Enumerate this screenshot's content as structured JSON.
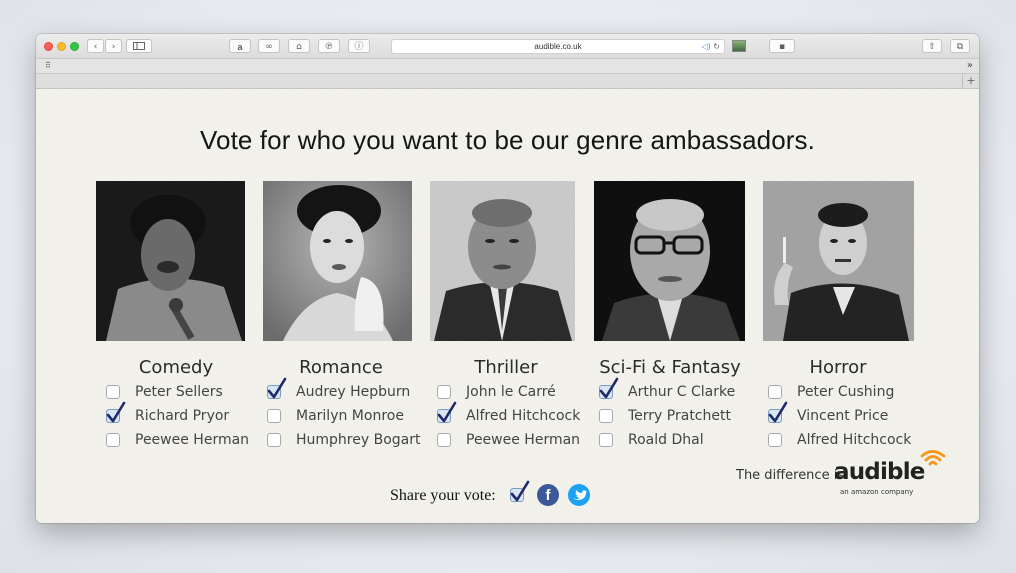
{
  "browser": {
    "url": "audible.co.uk",
    "colors": {
      "close": "#fc5f57",
      "minimize": "#fdbc2e",
      "zoom": "#33c748"
    },
    "toolbar_icons": [
      "back-icon",
      "forward-icon",
      "sidebar-icon",
      "amazon-icon",
      "link-icon",
      "home-icon",
      "pinterest-icon",
      "info-icon",
      "audio-icon",
      "reload-icon",
      "share-icon",
      "tabs-icon",
      "grid-icon",
      "new-tab-icon"
    ],
    "overflow_label": "»",
    "new_tab_label": "+"
  },
  "page": {
    "headline": "Vote for who you want to be our genre ambassadors.",
    "genres": [
      {
        "name": "Comedy",
        "options": [
          {
            "label": "Peter Sellers",
            "checked": false
          },
          {
            "label": "Richard Pryor",
            "checked": true
          },
          {
            "label": "Peewee Herman",
            "checked": false
          }
        ]
      },
      {
        "name": "Romance",
        "options": [
          {
            "label": "Audrey Hepburn",
            "checked": true
          },
          {
            "label": "Marilyn Monroe",
            "checked": false
          },
          {
            "label": "Humphrey Bogart",
            "checked": false
          }
        ]
      },
      {
        "name": "Thriller",
        "options": [
          {
            "label": "John le Carré",
            "checked": false
          },
          {
            "label": "Alfred Hitchcock",
            "checked": true
          },
          {
            "label": "Peewee Herman",
            "checked": false
          }
        ]
      },
      {
        "name": "Sci-Fi & Fantasy",
        "options": [
          {
            "label": "Arthur C Clarke",
            "checked": true
          },
          {
            "label": "Terry Pratchett",
            "checked": false
          },
          {
            "label": "Roald Dhal",
            "checked": false
          }
        ]
      },
      {
        "name": "Horror",
        "options": [
          {
            "label": "Peter Cushing",
            "checked": false
          },
          {
            "label": "Vincent Price",
            "checked": true
          },
          {
            "label": "Alfred Hitchcock",
            "checked": false
          }
        ]
      }
    ],
    "share": {
      "label": "Share your vote:",
      "facebook_glyph": "f",
      "colors": {
        "facebook": "#3b5998",
        "twitter": "#1da1f2"
      }
    },
    "brand": {
      "tagline": "The difference is",
      "name": "audible",
      "sub": "an amazon company",
      "accent": "#f7991c"
    }
  }
}
